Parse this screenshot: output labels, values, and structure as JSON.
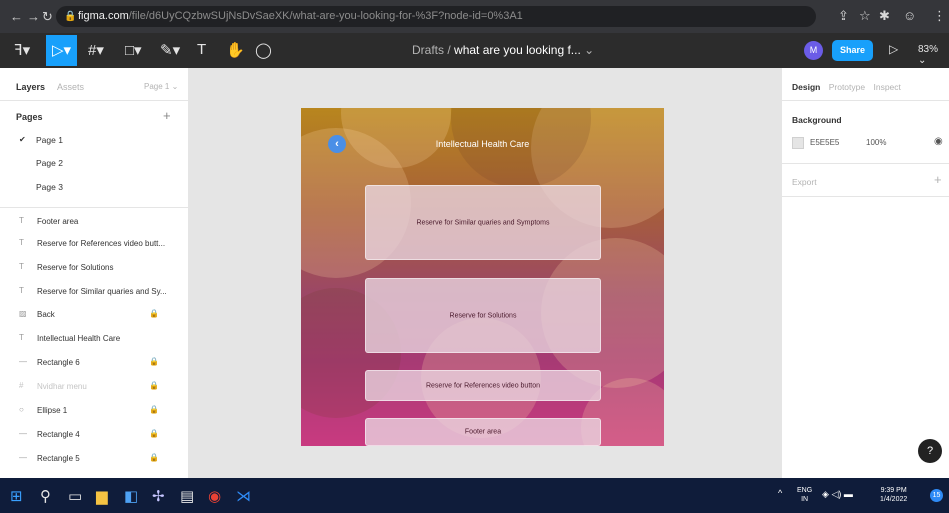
{
  "browser": {
    "url_host": "figma.com",
    "url_path": "/file/d6UyCQzbwSUjNsDvSaeXK/what-are-you-looking-for-%3F?node-id=0%3A1"
  },
  "toolbar": {
    "breadcrumb_parent": "Drafts",
    "breadcrumb_sep": "/",
    "file_name": "what are you looking f...",
    "avatar_initial": "M",
    "share_label": "Share",
    "zoom": "83%"
  },
  "left_panel": {
    "tabs": [
      "Layers",
      "Assets"
    ],
    "page_selector": "Page 1",
    "pages_title": "Pages",
    "pages": [
      "Page 1",
      "Page 2",
      "Page 3"
    ],
    "layers": [
      {
        "label": "Footer area",
        "icon": "text-icon",
        "locked": false,
        "dim": false
      },
      {
        "label": "Reserve for References video butt...",
        "icon": "text-icon",
        "locked": false,
        "dim": false
      },
      {
        "label": "Reserve for Solutions",
        "icon": "text-icon",
        "locked": false,
        "dim": false
      },
      {
        "label": "Reserve for Similar quaries and Sy...",
        "icon": "text-icon",
        "locked": false,
        "dim": false
      },
      {
        "label": "Back",
        "icon": "image-icon",
        "locked": true,
        "dim": false
      },
      {
        "label": "Intellectual Health Care",
        "icon": "text-icon",
        "locked": false,
        "dim": false
      },
      {
        "label": "Rectangle 6",
        "icon": "line-icon",
        "locked": true,
        "dim": false
      },
      {
        "label": "Nvidhar menu",
        "icon": "grid-icon",
        "locked": true,
        "dim": true
      },
      {
        "label": "Ellipse 1",
        "icon": "ellipse-icon",
        "locked": true,
        "dim": false
      },
      {
        "label": "Rectangle 4",
        "icon": "line-icon",
        "locked": true,
        "dim": false
      },
      {
        "label": "Rectangle 5",
        "icon": "line-icon",
        "locked": true,
        "dim": false
      }
    ]
  },
  "frame": {
    "title": "Intellectual Health Care",
    "cards": [
      "Reserve for Similar quaries and Symptoms",
      "Reserve for Solutions",
      "Reserve for References video button",
      "Footer area"
    ]
  },
  "right_panel": {
    "tabs": [
      "Design",
      "Prototype",
      "Inspect"
    ],
    "background_label": "Background",
    "background_hex": "E5E5E5",
    "background_opacity": "100%",
    "export_label": "Export"
  },
  "taskbar": {
    "lang_line1": "ENG",
    "lang_line2": "IN",
    "time": "9:39 PM",
    "date": "1/4/2022",
    "notif_count": "15"
  }
}
